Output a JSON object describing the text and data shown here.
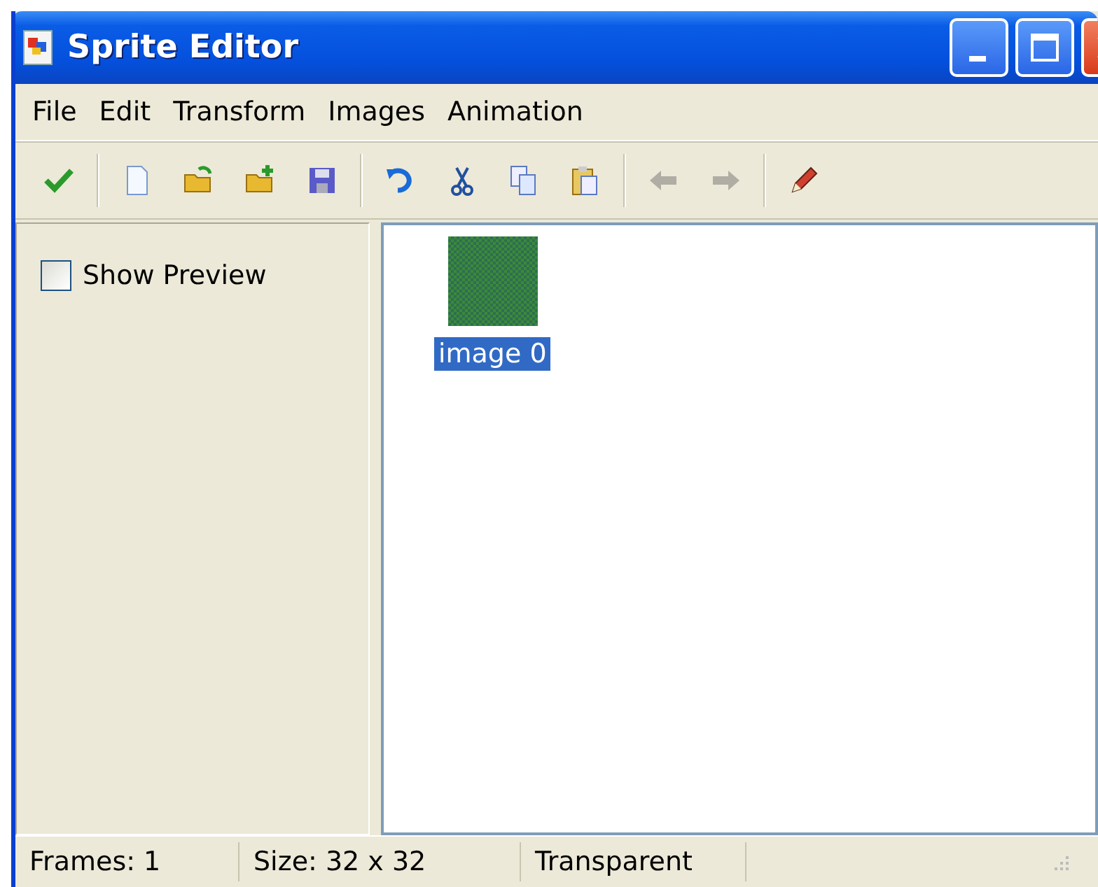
{
  "window": {
    "title": "Sprite Editor"
  },
  "menu": [
    "File",
    "Edit",
    "Transform",
    "Images",
    "Animation"
  ],
  "toolbar": [
    {
      "kind": "check",
      "disabled": false
    },
    {
      "kind": "separator"
    },
    {
      "kind": "new",
      "disabled": false
    },
    {
      "kind": "open",
      "disabled": false
    },
    {
      "kind": "add",
      "disabled": false
    },
    {
      "kind": "save",
      "disabled": false
    },
    {
      "kind": "separator"
    },
    {
      "kind": "undo",
      "disabled": false
    },
    {
      "kind": "cut",
      "disabled": false
    },
    {
      "kind": "copy",
      "disabled": false
    },
    {
      "kind": "paste",
      "disabled": false
    },
    {
      "kind": "separator"
    },
    {
      "kind": "back",
      "disabled": true
    },
    {
      "kind": "forward",
      "disabled": true
    },
    {
      "kind": "separator"
    },
    {
      "kind": "pencil",
      "disabled": false
    }
  ],
  "sidebar": {
    "show_preview": {
      "label": "Show Preview",
      "checked": false
    }
  },
  "images": [
    {
      "label": "image 0",
      "selected": true
    }
  ],
  "status_bar": [
    "Frames: 1",
    "Size: 32 x 32",
    "Transparent"
  ]
}
